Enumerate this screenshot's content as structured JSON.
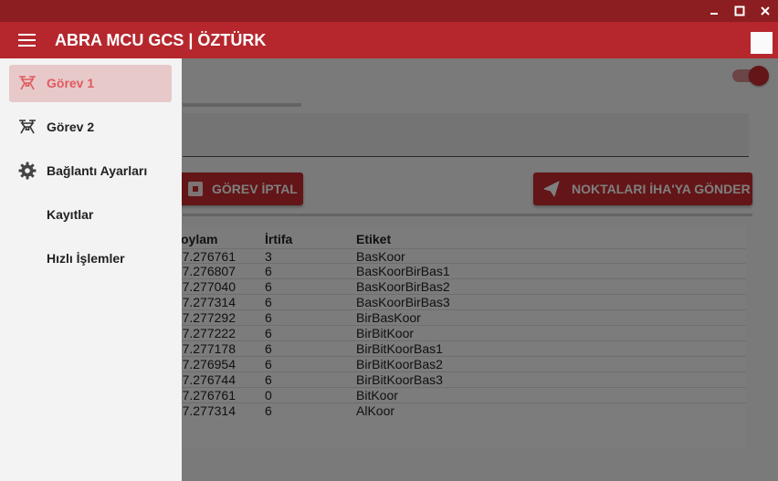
{
  "window": {
    "controls": [
      "minimize",
      "maximize",
      "close"
    ]
  },
  "appbar": {
    "title": "ABRA MCU GCS | ÖZTÜRK",
    "menu_icon": "hamburger-menu-icon"
  },
  "drawer": {
    "items": [
      {
        "label": "Görev 1",
        "icon": "drone-icon",
        "active": true
      },
      {
        "label": "Görev 2",
        "icon": "drone-icon",
        "active": false
      },
      {
        "label": "Bağlantı Ayarları",
        "icon": "gear-icon",
        "active": false
      },
      {
        "label": "Kayıtlar",
        "icon": "",
        "active": false
      },
      {
        "label": "Hızlı İşlemler",
        "icon": "",
        "active": false
      }
    ]
  },
  "content": {
    "toggle_on": true,
    "cancel_button": "GÖREV İPTAL",
    "send_button": "NOKTALARI İHA'YA GÖNDER",
    "table": {
      "headers": [
        "oylam",
        "İrtifa",
        "Etiket"
      ],
      "rows": [
        [
          "7.276761",
          "3",
          "BasKoor"
        ],
        [
          "7.276807",
          "6",
          "BasKoorBirBas1"
        ],
        [
          "7.277040",
          "6",
          "BasKoorBirBas2"
        ],
        [
          "7.277314",
          "6",
          "BasKoorBirBas3"
        ],
        [
          "7.277292",
          "6",
          "BirBasKoor"
        ],
        [
          "7.277222",
          "6",
          "BirBitKoor"
        ],
        [
          "7.277178",
          "6",
          "BirBitKoorBas1"
        ],
        [
          "7.276954",
          "6",
          "BirBitKoorBas2"
        ],
        [
          "7.276744",
          "6",
          "BirBitKoorBas3"
        ],
        [
          "7.276761",
          "0",
          "BitKoor"
        ],
        [
          "7.277314",
          "6",
          "AlKoor"
        ]
      ]
    }
  },
  "colors": {
    "titlebar": "#8c1d20",
    "appbar": "#b5272d",
    "accent": "#c62a2f",
    "active_label": "#e05a5f"
  }
}
